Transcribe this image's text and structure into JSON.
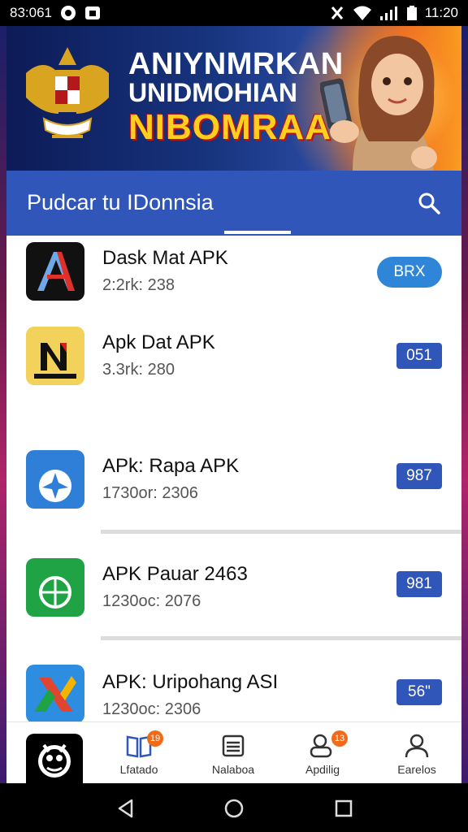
{
  "status_bar": {
    "time_left": "83:061",
    "time_right": "11:20",
    "icons": [
      "record-icon",
      "gallery-icon",
      "vibrate-icon",
      "wifi-icon",
      "signal-icon",
      "battery-icon"
    ]
  },
  "banner": {
    "line1": "ANIYNMRKAN",
    "line2": "UNIDMOHIAN",
    "line3": "NIBOMRAA",
    "emblem_icon": "garuda-emblem",
    "illustration": "woman-with-phone"
  },
  "search": {
    "label": "Pudcar tu IDonnsia",
    "icon": "search-icon"
  },
  "apps": [
    {
      "name": "Dask Mat APK",
      "meta": "2:2rk: 238",
      "button": "BRX",
      "icon": "letter-a-app-icon"
    },
    {
      "name": "Apk Dat APK",
      "meta": "3.3rk: 280",
      "button": "051",
      "icon": "letter-n-app-icon"
    },
    {
      "name": "APk: Rapa APK",
      "meta": "1730or: 2306",
      "button": "987",
      "icon": "airplane-app-icon"
    },
    {
      "name": "APK Pauar 2463",
      "meta": "1230oc: 2076",
      "button": "981",
      "icon": "globe-app-icon"
    },
    {
      "name": "APK: Uripohang ASI",
      "meta": "1230oc: 2306",
      "button": "56\"",
      "icon": "x-mark-app-icon"
    }
  ],
  "bottom_nav": {
    "items": [
      {
        "label": "Lfatado",
        "icon": "book-icon",
        "badge": "19"
      },
      {
        "label": "Nalaboa",
        "icon": "stack-icon",
        "badge": ""
      },
      {
        "label": "Apdilig",
        "icon": "users-icon",
        "badge": "13"
      },
      {
        "label": "Earelos",
        "icon": "person-icon",
        "badge": ""
      }
    ]
  },
  "system_nav": [
    "back-icon",
    "home-icon",
    "recents-icon"
  ],
  "colors": {
    "primary": "#2f56b8",
    "pill_button": "#2f86d8",
    "badge": "#f06a1a"
  }
}
